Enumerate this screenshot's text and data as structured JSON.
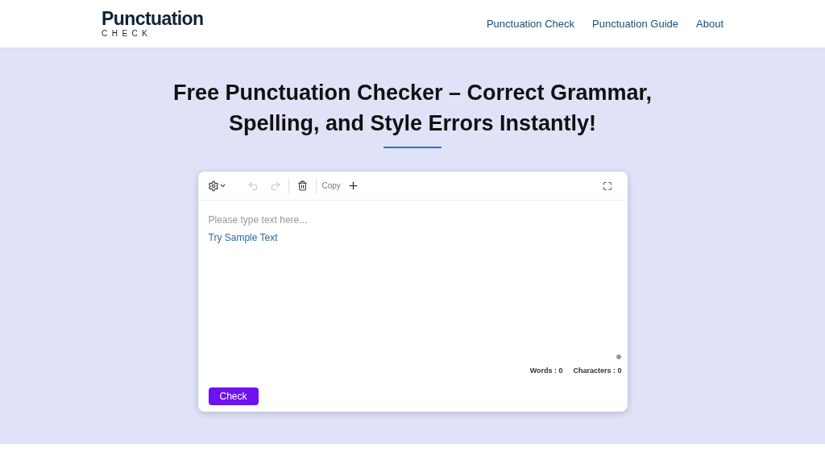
{
  "logo": {
    "title": "Punctuation",
    "subtitle": "CHECK"
  },
  "nav": [
    "Punctuation Check",
    "Punctuation Guide",
    "About"
  ],
  "heading": "Free Punctuation Checker – Correct Grammar, Spelling, and Style Errors Instantly!",
  "editor": {
    "toolbar": {
      "undo_disabled": true,
      "redo_disabled": true,
      "copy": "Copy"
    },
    "placeholder": "Please type text here...",
    "sample_link": "Try Sample Text",
    "counts": [
      {
        "label": "Words : 0"
      },
      {
        "label": "Characters : 0"
      }
    ],
    "button": "Check"
  }
}
